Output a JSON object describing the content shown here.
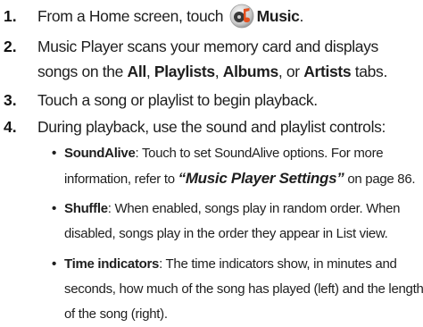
{
  "steps": [
    {
      "num": "1.",
      "a": "From a Home screen, touch ",
      "icon": "music-player-icon",
      "b": "Music",
      "c": "."
    },
    {
      "num": "2.",
      "l1": "Music Player scans your memory card and displays",
      "l2a": "songs on the ",
      "t1": "All",
      "sep1": ", ",
      "t2": "Playlists",
      "sep2": ", ",
      "t3": "Albums",
      "sep3": ", or ",
      "t4": "Artists",
      "l2end": " tabs."
    },
    {
      "num": "3.",
      "text": "Touch a song or playlist to begin playback."
    },
    {
      "num": "4.",
      "text": "During playback, use the sound and playlist controls:"
    }
  ],
  "bullets": {
    "dot": "•",
    "soundalive": {
      "term": "SoundAlive",
      "l1": ": Touch to set SoundAlive options. For more",
      "l2a": "information, refer to ",
      "ref": "“Music Player Settings”",
      "l2b": "  on page 86."
    },
    "shuffle": {
      "term": "Shuffle",
      "l1": ": When enabled, songs play in random order. When",
      "l2": "disabled, songs play in the order they appear in List view."
    },
    "time": {
      "term": "Time indicators",
      "l1": ": The time indicators show, in minutes and",
      "l2": "seconds, how much of the song has played (left) and the length",
      "l3": "of the song (right)."
    }
  }
}
